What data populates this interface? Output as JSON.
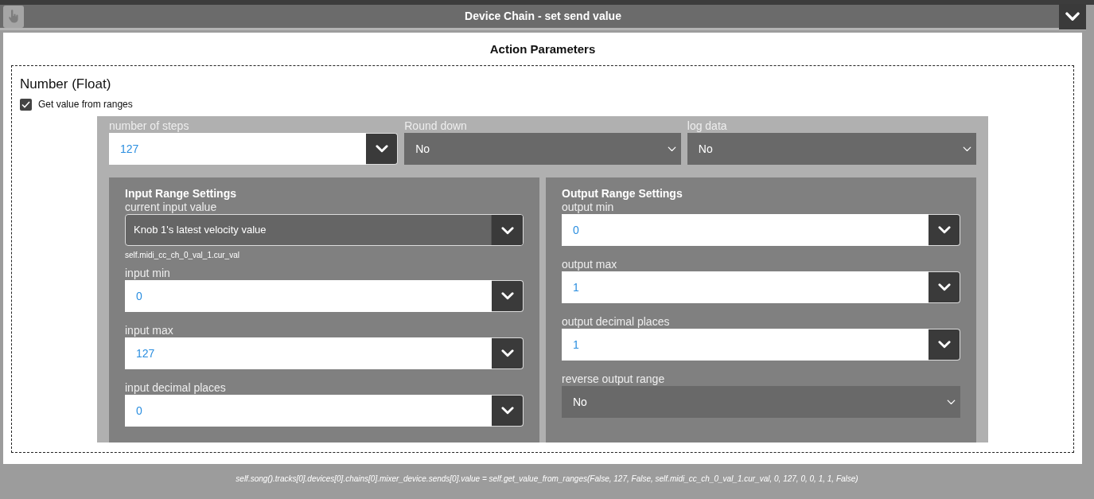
{
  "header": {
    "title": "Device Chain - set send value"
  },
  "panel": {
    "title": "Action Parameters"
  },
  "parameter": {
    "title": "Number (Float)",
    "checkbox": {
      "label": "Get value from ranges",
      "checked": true
    }
  },
  "top_fields": [
    {
      "label": "number of steps",
      "value": "127",
      "kind": "combo"
    },
    {
      "label": "Round down",
      "value": "No",
      "kind": "select"
    },
    {
      "label": "log data",
      "value": "No",
      "kind": "select"
    }
  ],
  "input_range": {
    "title": "Input Range Settings",
    "fields": [
      {
        "label": "current input value",
        "value": "Knob 1's latest velocity value",
        "kind": "picker",
        "hint": "self.midi_cc_ch_0_val_1.cur_val"
      },
      {
        "label": "input min",
        "value": "0",
        "kind": "combo"
      },
      {
        "label": "input max",
        "value": "127",
        "kind": "combo"
      },
      {
        "label": "input decimal places",
        "value": "0",
        "kind": "combo"
      }
    ]
  },
  "output_range": {
    "title": "Output Range Settings",
    "fields": [
      {
        "label": "output min",
        "value": "0",
        "kind": "combo"
      },
      {
        "label": "output max",
        "value": "1",
        "kind": "combo"
      },
      {
        "label": "output decimal places",
        "value": "1",
        "kind": "combo"
      },
      {
        "label": "reverse output range",
        "value": "No",
        "kind": "select"
      }
    ]
  },
  "footer": "self.song().tracks[0].devices[0].chains[0].mixer_device.sends[0].value = self.get_value_from_ranges(False, 127, False, self.midi_cc_ch_0_val_1.cur_val, 0, 127, 0, 0, 1, 1, False)"
}
